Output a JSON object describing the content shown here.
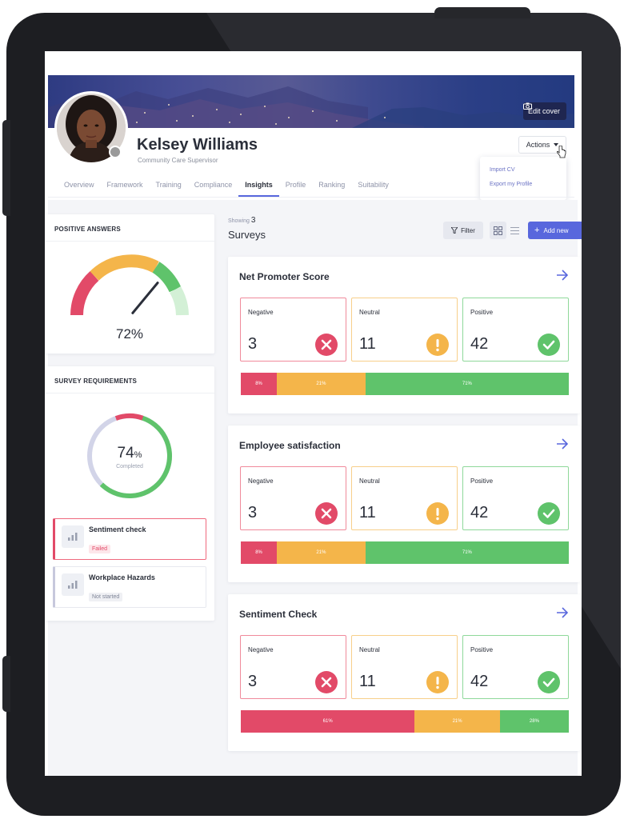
{
  "profile": {
    "name": "Kelsey Williams",
    "role": "Community Care Supervisor",
    "edit_cover_label": "Edit cover",
    "actions_label": "Actions",
    "actions_menu": [
      "Import CV",
      "Export my Profile"
    ]
  },
  "tabs": [
    "Overview",
    "Framework",
    "Training",
    "Compliance",
    "Insights",
    "Profile",
    "Ranking",
    "Suitability"
  ],
  "active_tab": "Insights",
  "positive_answers": {
    "title": "POSITIVE ANSWERS",
    "value": "72%",
    "percent": 72,
    "colors": {
      "red": "#e24a68",
      "orange": "#f4b54a",
      "green": "#5fc36b",
      "light_green": "#d3f0d6"
    }
  },
  "survey_requirements": {
    "title": "SURVEY REQUIREMENTS",
    "percent_number": "74",
    "percent_sign": "%",
    "completed_label": "Completed",
    "items": [
      {
        "name": "Sentiment check",
        "status": "Failed"
      },
      {
        "name": "Workplace Hazards",
        "status": "Not started"
      }
    ]
  },
  "surveys_header": {
    "showing_label": "Showing",
    "showing_count": "3",
    "title": "Surveys",
    "filter_label": "Filter",
    "add_label": "Add new"
  },
  "surveys": [
    {
      "title": "Net Promoter Score",
      "negative_label": "Negative",
      "negative": "3",
      "neutral_label": "Neutral",
      "neutral": "11",
      "positive_label": "Positive",
      "positive": "42",
      "bar": [
        {
          "label": "8%",
          "value": 11
        },
        {
          "label": "21%",
          "value": 27
        },
        {
          "label": "71%",
          "value": 62
        }
      ]
    },
    {
      "title": "Employee satisfaction",
      "negative_label": "Negative",
      "negative": "3",
      "neutral_label": "Neutral",
      "neutral": "11",
      "positive_label": "Positive",
      "positive": "42",
      "bar": [
        {
          "label": "8%",
          "value": 11
        },
        {
          "label": "21%",
          "value": 27
        },
        {
          "label": "71%",
          "value": 62
        }
      ]
    },
    {
      "title": "Sentiment Check",
      "negative_label": "Negative",
      "negative": "3",
      "neutral_label": "Neutral",
      "neutral": "11",
      "positive_label": "Positive",
      "positive": "42",
      "bar": [
        {
          "label": "61%",
          "value": 53
        },
        {
          "label": "21%",
          "value": 26
        },
        {
          "label": "28%",
          "value": 21
        }
      ]
    }
  ],
  "accent_color": "#5867dd"
}
